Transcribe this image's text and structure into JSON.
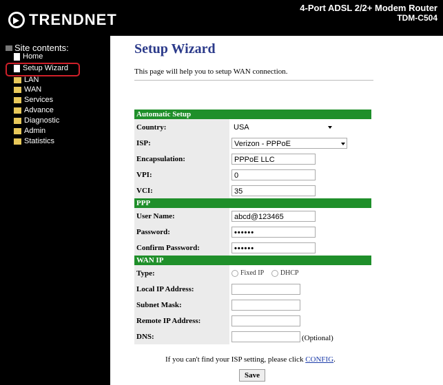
{
  "header": {
    "brand": "TRENDNET",
    "model_title": "4-Port ADSL 2/2+ Modem Router",
    "model_code": "TDM-C504"
  },
  "sidebar": {
    "heading": "Site contents:",
    "items": [
      {
        "label": "Home",
        "icon": "doc-icon"
      },
      {
        "label": "Setup Wizard",
        "icon": "doc-icon"
      },
      {
        "label": "LAN",
        "icon": "folder-icon"
      },
      {
        "label": "WAN",
        "icon": "folder-icon"
      },
      {
        "label": "Services",
        "icon": "folder-icon"
      },
      {
        "label": "Advance",
        "icon": "folder-icon"
      },
      {
        "label": "Diagnostic",
        "icon": "folder-icon"
      },
      {
        "label": "Admin",
        "icon": "folder-icon"
      },
      {
        "label": "Statistics",
        "icon": "folder-icon"
      }
    ]
  },
  "main": {
    "title": "Setup Wizard",
    "description": "This page will help you to setup WAN connection."
  },
  "form": {
    "automatic_setup": {
      "section": "Automatic Setup",
      "country_label": "Country:",
      "country_value": "USA",
      "isp_label": "ISP:",
      "isp_value": "Verizon - PPPoE",
      "encapsulation_label": "Encapsulation:",
      "encapsulation_value": "PPPoE LLC",
      "vpi_label": "VPI:",
      "vpi_value": "0",
      "vci_label": "VCI:",
      "vci_value": "35"
    },
    "ppp": {
      "section": "PPP",
      "username_label": "User Name:",
      "username_value": "abcd@123465",
      "password_label": "Password:",
      "password_value": "••••••",
      "confirm_label": "Confirm Password:",
      "confirm_value": "••••••"
    },
    "wan_ip": {
      "section": "WAN IP",
      "type_label": "Type:",
      "type_options": [
        "Fixed IP",
        "DHCP"
      ],
      "local_ip_label": "Local IP Address:",
      "subnet_label": "Subnet Mask:",
      "remote_ip_label": "Remote IP Address:",
      "dns_label": "DNS:",
      "dns_optional": "(Optional)"
    }
  },
  "footer": {
    "hint_text": "If you can't find your ISP setting, please click",
    "hint_link": "CONFIG",
    "hint_end": ".",
    "save_label": "Save"
  },
  "colors": {
    "section_header": "#1f8f2a",
    "title": "#2b3a8a",
    "highlight": "#d0202a"
  }
}
